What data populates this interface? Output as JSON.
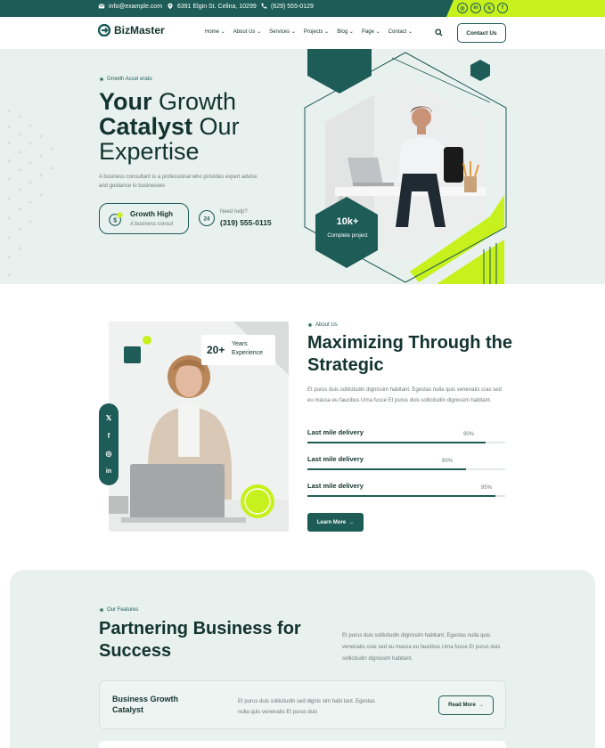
{
  "colors": {
    "primary": "#1d5c57",
    "accent": "#c6f11c",
    "background_tint": "#e9f1ee"
  },
  "topbar": {
    "email": "info@example.com",
    "address": "6391 Elgin St. Celina, 10299",
    "phone": "(629) 555-0129",
    "social_icons": [
      "instagram-icon",
      "linkedin-icon",
      "x-icon",
      "facebook-icon"
    ]
  },
  "header": {
    "logo_text": "BizMaster",
    "nav": [
      "Home",
      "About Us",
      "Services",
      "Projects",
      "Blog",
      "Page",
      "Contact"
    ],
    "contact_label": "Contact Us"
  },
  "hero": {
    "eyebrow": "Growth Accel erato",
    "title_bold_1": "Your",
    "title_thin_1": " Growth",
    "title_bold_2": "Catalyst",
    "title_thin_2": " Our",
    "title_thin_3": "Expertise",
    "description": "A business consultant is a professional who provides expert advice and guidance to businesses",
    "card_title": "Growth High",
    "card_sub": "A business consul",
    "help_label": "Need help?",
    "help_phone": "(319) 555-0115",
    "stat_value": "10k+",
    "stat_label": "Complete project"
  },
  "about": {
    "years_value": "20+",
    "years_label": "Years Experience",
    "eyebrow": "About Us",
    "title": "Maximizing Through the Strategic",
    "description": "Et purus duis sollicitudin dignissim habitant. Egestas nulla quis venenatis cras sed eu massa eu faucibus Urna fusce Et purus duis sollicitudin dignissim habitant.",
    "bars": [
      {
        "label": "Last mile delivery",
        "percent_text": "90%",
        "value": 0.9
      },
      {
        "label": "Last mile delivery",
        "percent_text": "80%",
        "value": 0.8
      },
      {
        "label": "Last mile delivery",
        "percent_text": "95%",
        "value": 0.95
      }
    ],
    "button_label": "Learn More",
    "social_icons": [
      "x-icon",
      "facebook-icon",
      "instagram-icon",
      "linkedin-icon"
    ]
  },
  "features": {
    "eyebrow": "Our Features",
    "title": "Partnering Business for Success",
    "description": "Et purus duis sollicitudin dignissim habitant. Egestas nulla quis venenatis cras sed eu massa eu faucibus Urna fusce Et purus duis sollicitudin dignissim habitant.",
    "card_title": "Business Growth Catalyst",
    "card_desc": "Et purus duis sollicitudin sed dignis sim habi tant. Egestas nulla quis venenatis Et purus duis",
    "card_button": "Read More"
  }
}
